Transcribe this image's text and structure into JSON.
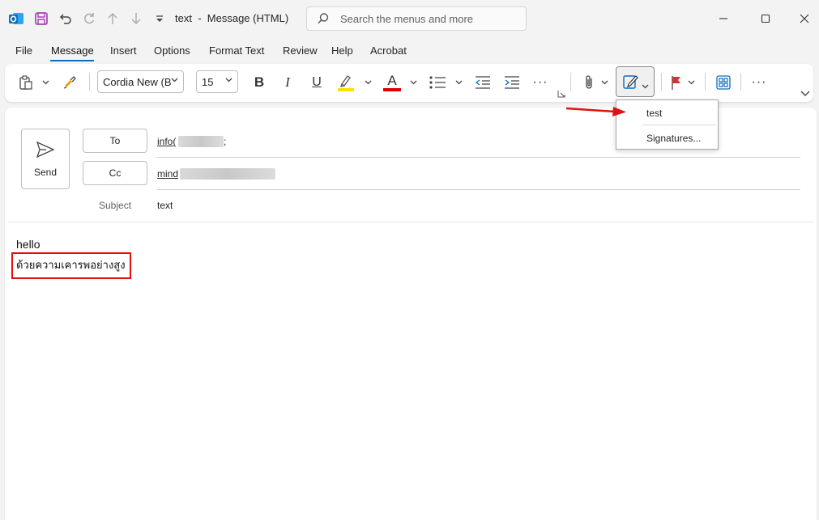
{
  "window": {
    "title": "text",
    "separator": "-",
    "subtitle": "Message (HTML)",
    "search_placeholder": "Search the menus and more"
  },
  "menu_tabs": [
    "File",
    "Message",
    "Insert",
    "Options",
    "Format Text",
    "Review",
    "Help",
    "Acrobat"
  ],
  "active_tab": "Message",
  "ribbon": {
    "font_name": "Cordia New (B",
    "font_size": "15",
    "bold": "B",
    "italic": "I",
    "underline": "U",
    "font_color_glyph": "A",
    "more": "···"
  },
  "signature_dropdown": {
    "items": [
      "test",
      "Signatures..."
    ]
  },
  "compose": {
    "send_label": "Send",
    "to_label": "To",
    "cc_label": "Cc",
    "to_value": "info(",
    "to_suffix": ";",
    "cc_value": "mind",
    "subject_label": "Subject",
    "subject_value": "text",
    "body_line1": "hello",
    "body_line2": "ด้วยความเคารพอย่างสูง"
  },
  "colors": {
    "accent": "#0f6cbd",
    "highlight_bar": "#ffe000",
    "font_color_bar": "#e00000",
    "annotation_red": "#e01010",
    "outlook_blue": "#0f6cbd",
    "save_purple": "#a23ab0"
  }
}
